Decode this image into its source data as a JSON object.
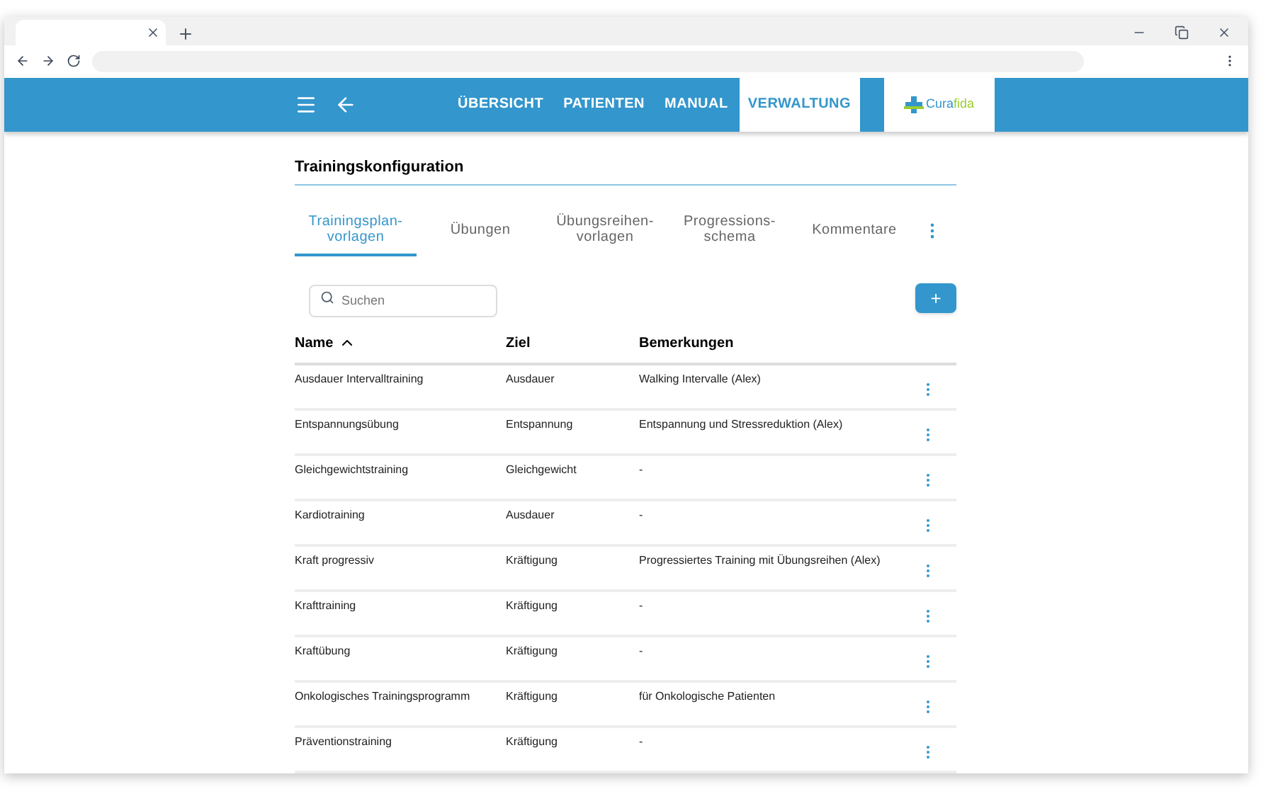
{
  "nav": {
    "items": [
      {
        "label": "ÜBERSICHT",
        "selected": false
      },
      {
        "label": "PATIENTEN",
        "selected": false
      },
      {
        "label": "MANUAL",
        "selected": false
      },
      {
        "label": "VERWALTUNG",
        "selected": true
      }
    ],
    "logo_text": [
      "Cura",
      "fida"
    ]
  },
  "page": {
    "title": "Trainingskonfiguration"
  },
  "tabs": [
    {
      "label": "Trainingsplan-\nvorlagen",
      "selected": true
    },
    {
      "label": "Übungen",
      "selected": false
    },
    {
      "label": "Übungsreihen-\nvorlagen",
      "selected": false
    },
    {
      "label": "Progressions-\nschema",
      "selected": false
    },
    {
      "label": "Kommentare",
      "selected": false
    }
  ],
  "search": {
    "placeholder": "Suchen"
  },
  "add_button": {
    "label": "+"
  },
  "table": {
    "columns": [
      "Name",
      "Ziel",
      "Bemerkungen"
    ],
    "rows": [
      [
        "Ausdauer Intervalltraining",
        "Ausdauer",
        "Walking Intervalle (Alex)"
      ],
      [
        "Entspannungsübung",
        "Entspannung",
        "Entspannung und Stressreduktion (Alex)"
      ],
      [
        "Gleichgewichtstraining",
        "Gleichgewicht",
        "-"
      ],
      [
        "Kardiotraining",
        "Ausdauer",
        "-"
      ],
      [
        "Kraft progressiv",
        "Kräftigung",
        "Progressiertes Training mit Übungsreihen (Alex)"
      ],
      [
        "Krafttraining",
        "Kräftigung",
        "-"
      ],
      [
        "Kraftübung",
        "Kräftigung",
        "-"
      ],
      [
        "Onkologisches Trainingsprogramm",
        "Kräftigung",
        "für Onkologische Patienten"
      ],
      [
        "Präventionstraining",
        "Kräftigung",
        "-"
      ]
    ]
  }
}
